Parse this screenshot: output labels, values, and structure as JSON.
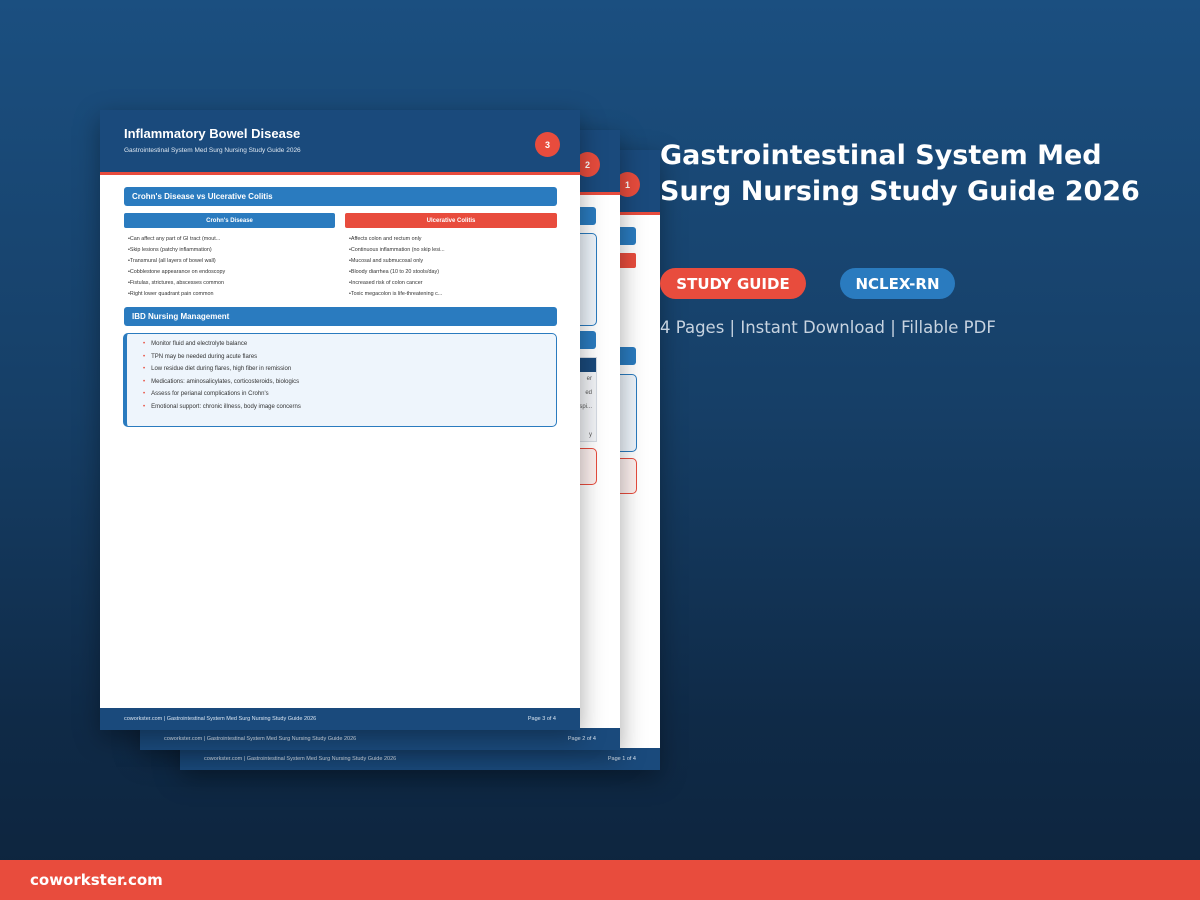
{
  "product": {
    "title": "Gastrointestinal System Med Surg Nursing Study Guide 2026",
    "badges": [
      "STUDY GUIDE",
      "NCLEX-RN"
    ],
    "meta": "4 Pages | Instant Download | Fillable PDF"
  },
  "brand": "coworkster.com",
  "pages": [
    {
      "number": "1",
      "footer_left": "coworkster.com | Gastrointestinal System Med Surg Nursing Study Guide 2026",
      "footer_right": "Page 1 of 4"
    },
    {
      "number": "2",
      "footer_left": "coworkster.com | Gastrointestinal System Med Surg Nursing Study Guide 2026",
      "footer_right": "Page 2 of 4",
      "table_fragments": [
        "er",
        "ed",
        "espi...",
        "y"
      ]
    },
    {
      "number": "3",
      "title": "Inflammatory Bowel Disease",
      "subtitle": "Gastrointestinal System Med Surg Nursing Study Guide 2026",
      "section1": "Crohn's Disease vs Ulcerative Colitis",
      "col1": {
        "header": "Crohn's Disease",
        "items": [
          "Can affect any part of GI tract (mout...",
          "Skip lesions (patchy inflammation)",
          "Transmural (all layers of bowel wall)",
          "Cobblestone appearance on endoscopy",
          "Fistulas, strictures, abscesses common",
          "Right lower quadrant pain common"
        ]
      },
      "col2": {
        "header": "Ulcerative Colitis",
        "items": [
          "Affects colon and rectum only",
          "Continuous inflammation (no skip lesi...",
          "Mucosal and submucosal only",
          "Bloody diarrhea (10 to 20 stools/day)",
          "Increased risk of colon cancer",
          "Toxic megacolon is life-threatening c..."
        ]
      },
      "section2": "IBD Nursing Management",
      "management": [
        "Monitor fluid and electrolyte balance",
        "TPN may be needed during acute flares",
        "Low residue diet during flares, high fiber in remission",
        "Medications: aminosalicylates, corticosteroids, biologics",
        "Assess for perianal complications in Crohn's",
        "Emotional support: chronic illness, body image concerns"
      ],
      "footer_left": "coworkster.com | Gastrointestinal System Med Surg Nursing Study Guide 2026",
      "footer_right": "Page 3 of 4"
    }
  ],
  "colors": {
    "navy": "#1a4a7c",
    "blue": "#2a7bbf",
    "red": "#e84c3d"
  }
}
